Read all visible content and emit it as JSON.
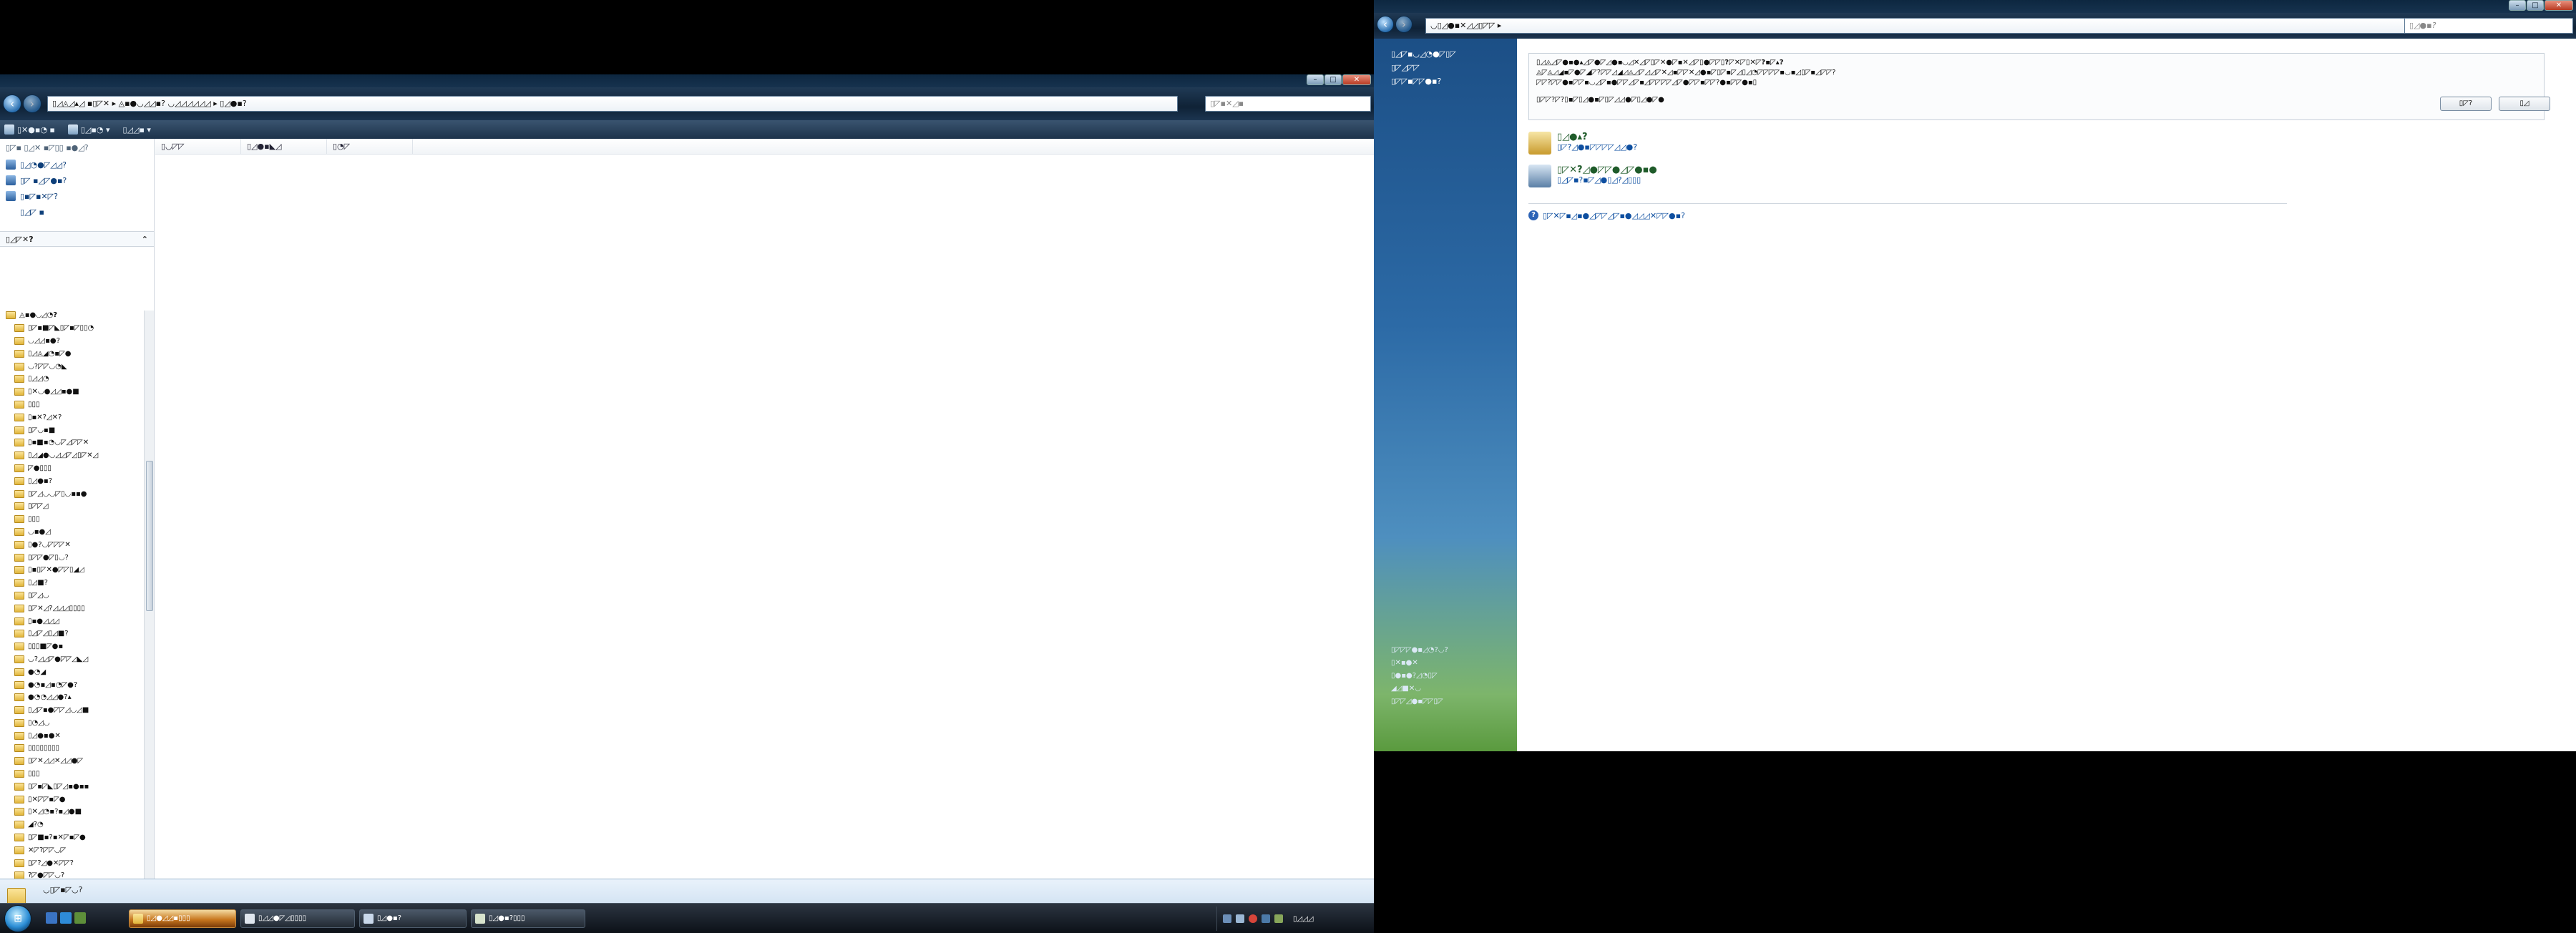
{
  "explorer": {
    "address": "▯◿◬◿▴◿ ▪▯◸✕ ▸ ◬▪●◡◿◿▪? ◡◿◿◿◿◿◿ ▸ ▯◿●▪?",
    "search_placeholder": "▯◸▪✕◿▪",
    "toolbar": [
      "▯✕●▪◔ ▪",
      "▯◿▪◔ ▾",
      "▯◿◿▪ ▾"
    ],
    "favorites_title": "▯◸▪ ▯◿✕ ▪◸▯▯ ▪●◿?",
    "favorite_links": [
      "▯◿◔●◸◿◿?",
      "▯◸ ▪◿◸●▪?",
      "▯▪◸▪✕◸?",
      "▯◿◸ ▪"
    ],
    "folders_label": "▯◿◸✕?",
    "tree_root": "◬▪●◡◿◔?",
    "folders": [
      "▯◸▪■◸◣▯◸▪◸▯▯◔",
      "◡◿◿▪●?",
      "▯◿◬◢◔▪◸●",
      "◡?◸◸◡◔◣",
      "▯◿◿◔",
      "▯✕◡●◿◿▪●■",
      "▯▯▯",
      "▯▪✕?◿✕?",
      "▯◸◡▪■",
      "▯▪■▪◔◡◸◿◸◸✕",
      "▯◿◢●◡◿◿◸◿▯◸✕◿",
      "◸●▯▯▯",
      "▯◿●▪?",
      "▯◸◿◡◡◸▯◡▪▪●",
      "▯◸◸◿",
      "▯▯▯",
      "◡▪●◿",
      "▯●?◡◸◸◸✕",
      "▯◸◸●◸▯◡?",
      "▯▪▯◸✕●◸◸▯◢◿",
      "▯◿■?",
      "▯◸◿◡",
      "▯◸✕◿?◿◿◿▯▯▯▯",
      "▯▪●◿◿◿",
      "▯◿◸◿▯◿■?",
      "▯▯▯■◸●▪",
      "◡?◿◿◸●◸◸◿◣◿",
      "●◔◢",
      "●◔▪◿▪◔◸●?",
      "●◔◔◿◿●?▴",
      "▯◿◸▪●◸◸◿◡◿■",
      "▯◔◿◡",
      "▯◿●▪●✕",
      "▯▯▯▯▯▯▯▯",
      "▯◸✕◿◿✕◿◿●◸",
      "▯▯▯",
      "▯◸▪◸◣▯◸◿▪●▪▪",
      "▯✕◸◸▪◸●",
      "▯✕◿◔▪?▪◿●■",
      "◢?◔",
      "▯◸■▪?▪✕◸▪◸●",
      "✕◸?◸◸◡◸",
      "▯◸?◿●✕◸◸?",
      "?◸●◸◸◡?",
      "?◸◸◸✕▪◣",
      "▯◸✕◔▪◸◸◿✕◿◿◸",
      "?◸✕◔▪◸▪●■"
    ],
    "columns": [
      "▯◡◸◸",
      "▯◿●▪◣◿",
      "▯◔◸"
    ],
    "details_text": "◡▯◸▪◸◡?"
  },
  "cpanel": {
    "address": "◡▯◿●▪✕◿◿▯◸◸ ▸",
    "search_placeholder": "▯◿●▪?",
    "sidebar_links": [
      "▯◿◸▪◡◿◔●◸▯◸",
      "▯◸◿◸◸",
      "▯◸◸▪◸◸●▪?"
    ],
    "sidebar_bottom": [
      "▯◸◸◸●▪◿◔?◡?",
      "▯✕▪●✕",
      "▯●▪●?◿◔▯◸",
      "◢◿■✕◡",
      "▯◸◸◿●▪◸◸▯◸"
    ],
    "info_lines": [
      "▯◿◬◿◸●▪●▴◿◸●◸◿●▪◡◿✕◿◸▯◸✕●◸▪✕◿◸▯●◸◸▯?◸✕◸▯✕◸?▪◸▴?",
      "◬◸◬◿◢▪◸●◸◢◸?◸◸◿◢◿◬◿◸◿◿◸✕◿▪◸◸✕◿●▪◸▯◸▪◸◿▯◿◔◸◸◸◸▪◡▪◿▯◸▪◿◸◸?",
      "◸◸?◸◸●▪◸◸▪◡◿◸▪●◸◸◿◸▪◿◸◸◸◸◿◸●◸◸▪◸◸?●▪◸◸●▪▯",
      "▯◸◸?◸?▯▪◸▯◿●▪◸▯◸◿◿●◸▯◿●◸●"
    ],
    "buttons": {
      "ok": "▯◸?",
      "cancel": "▯◿"
    },
    "categories": [
      {
        "title": "▯◿●▴?",
        "link": "▯◸?◿●▪◸◸◸◸◿◿●?"
      },
      {
        "title": "▯◸✕?◿●◸◸●◿◸●▪●",
        "link": "▯◿◸▪?▪◸◿●▯◿?◿▯▯▯"
      }
    ],
    "help": "▯◸✕◸▪◿▪●◿◸◸◿◸▪●◿◿◿✕◸◸●▪?"
  },
  "taskbar": {
    "tasks": [
      "▯◿●◿◿▪▯▯▯",
      "▯◿◿●◸◿▯▯▯▯",
      "▯◿●▪?",
      "▯◿●▪?▯▯▯"
    ],
    "clock": "▯◿◿◿"
  },
  "colors": {
    "accent": "#2c6aa6",
    "active_task": "#c8781f",
    "link": "#0e4fa0"
  }
}
